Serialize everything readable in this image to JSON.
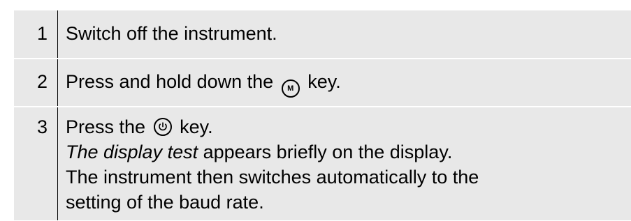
{
  "steps": [
    {
      "number": "1",
      "text": "Switch off the instrument."
    },
    {
      "number": "2",
      "before_key": "Press and hold down the",
      "key_icon": "m-key-icon",
      "key_letter": "M",
      "after_key": "key."
    },
    {
      "number": "3",
      "before_key": "Press the",
      "key_icon": "power-key-icon",
      "after_key": "key.",
      "line2_italic": "The display test",
      "line2_rest": "appears briefly on the display.",
      "line3": "The instrument then switches automatically to the",
      "line4": "setting of the baud rate."
    }
  ]
}
